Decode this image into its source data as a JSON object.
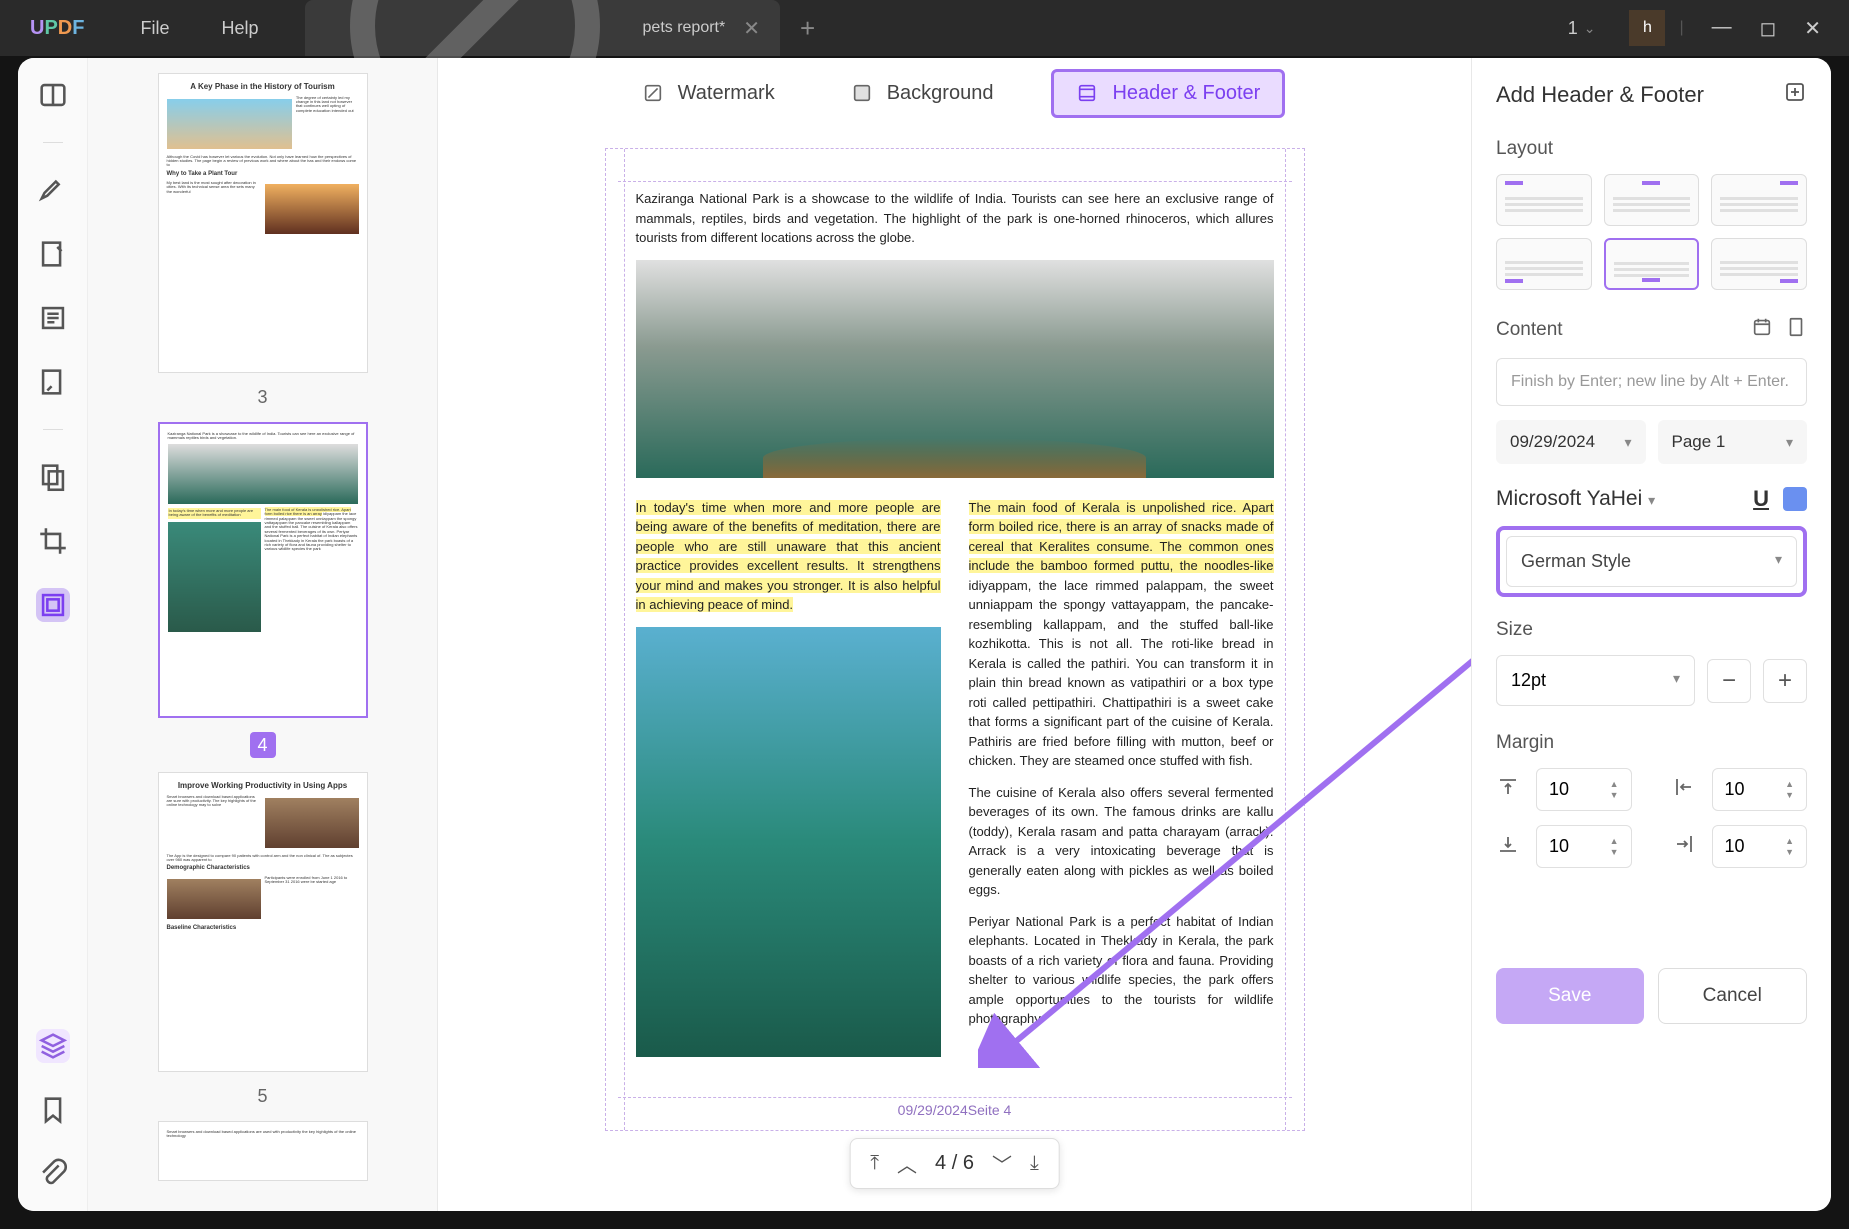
{
  "app": {
    "logo": "UPDF"
  },
  "menu": {
    "file": "File",
    "help": "Help"
  },
  "tab": {
    "title": "pets report*"
  },
  "zoom": {
    "value": "1"
  },
  "user": {
    "initial": "h"
  },
  "toolbar": {
    "watermark": "Watermark",
    "background": "Background",
    "header_footer": "Header & Footer"
  },
  "thumbnails": [
    {
      "num": "3",
      "title": "A Key Phase in the History of Tourism",
      "subtitle": "Why to Take a Plant Tour"
    },
    {
      "num": "4",
      "selected": true
    },
    {
      "num": "5",
      "title": "Improve Working Productivity in Using Apps",
      "sect1": "Demographic Characteristics",
      "sect2": "Baseline Characteristics"
    }
  ],
  "page": {
    "intro": "Kaziranga National Park is a showcase to the wildlife of India. Tourists can see here an exclusive range of mammals, reptiles, birds and vegetation. The highlight of the park is one-horned rhinoceros, which allures tourists from different locations across the globe.",
    "left_hl": "In today's time when more and more people are being aware of the benefits of meditation, there are people who are still unaware that this ancient practice provides excellent results. It strengthens your mind and makes you stronger. It is also helpful in achieving peace of mind.",
    "right_hl": "The main food of Kerala is unpolished rice. Apart form boiled rice, there is an array of snacks made of cereal that Keralites consume. The common ones include the bamboo formed puttu, the noodles-like",
    "right_body1": "idiyappam, the lace rimmed palappam, the sweet unniappam the spongy vattayappam, the pancake-resembling kallappam, and the stuffed ball-like kozhikotta. This is not all. The roti-like bread in Kerala is called the pathiri. You can transform it in plain thin bread known as vatipathiri or a box type roti called pettipathiri. Chattipathiri is a sweet cake that forms a significant part of the cuisine of Kerala. Pathiris are fried before filling with mutton, beef or chicken. They are steamed once stuffed with fish.",
    "right_body2": "The cuisine of Kerala also offers several fermented beverages of its own. The famous drinks are kallu (toddy), Kerala rasam and patta charayam (arrack). Arrack is a very intoxicating beverage that is generally eaten along with pickles as well as boiled eggs.",
    "right_body3": "Periyar National Park is a perfect habitat of Indian elephants. Located in Thekkady in Kerala, the park boasts of a rich variety of flora and fauna. Providing shelter to various wildlife species, the park offers ample opportunities to the tourists for wildlife photography.",
    "footer": "09/29/2024Seite 4"
  },
  "pager": {
    "current": "4",
    "sep": "/",
    "total": "6"
  },
  "panel": {
    "title": "Add Header & Footer",
    "layout_label": "Layout",
    "content_label": "Content",
    "content_placeholder": "Finish by Enter; new line by Alt + Enter.",
    "date": "09/29/2024",
    "page_label": "Page 1",
    "font": "Microsoft YaHei",
    "style": "German Style",
    "size_label": "Size",
    "size_value": "12pt",
    "margin_label": "Margin",
    "margins": {
      "top": "10",
      "left": "10",
      "bottom": "10",
      "right": "10"
    },
    "save": "Save",
    "cancel": "Cancel"
  }
}
